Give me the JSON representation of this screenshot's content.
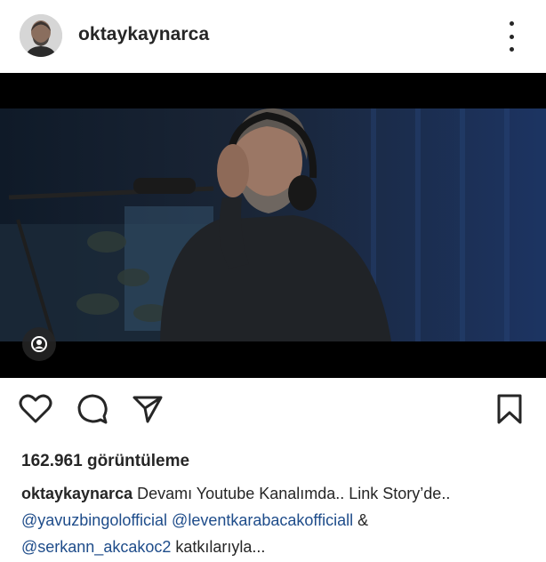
{
  "post": {
    "username": "oktaykaynarca",
    "views_count": "162.961",
    "views_label": "görüntüleme",
    "caption": {
      "username": "oktaykaynarca",
      "text": "Devamı Youtube Kanalımda.. Link Story’de..",
      "mention_1": "@yavuzbingolofficial",
      "mention_2": "@leventkarabacakofficiall",
      "amp": "&",
      "mention_3": "@serkann_akcakoc2",
      "suffix": "katkılarıyla..."
    }
  },
  "icons": {
    "more": "more-vertical-icon",
    "tag": "user-tag-icon",
    "like": "heart-icon",
    "comment": "comment-icon",
    "share": "share-icon",
    "save": "bookmark-icon"
  },
  "colors": {
    "text": "#262626",
    "mention": "#1e4c8a",
    "media_bg": "#000000"
  }
}
